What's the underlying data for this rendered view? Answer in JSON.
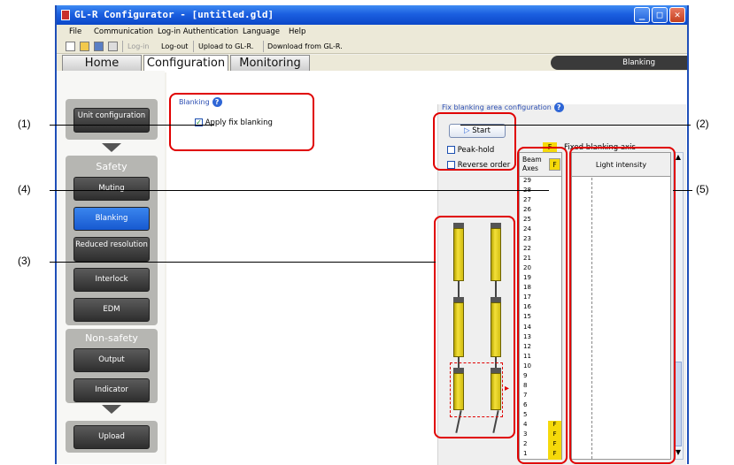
{
  "window": {
    "title": "GL-R Configurator - [untitled.gld]"
  },
  "menu": [
    "File",
    "Communication",
    "Log-in Authentication",
    "Language",
    "Help"
  ],
  "toolbar": {
    "login": "Log-in",
    "logout": "Log-out",
    "upload": "Upload to GL-R.",
    "download": "Download from GL-R."
  },
  "tabs": [
    "Home",
    "Configuration",
    "Monitoring"
  ],
  "status": "Blanking",
  "nav": {
    "unit_config": "Unit configuration",
    "safety": "Safety",
    "muting": "Muting",
    "blanking": "Blanking",
    "reduced": "Reduced resolution",
    "interlock": "Interlock",
    "edm": "EDM",
    "nonsafety": "Non-safety",
    "output": "Output",
    "indicator": "Indicator",
    "upload": "Upload"
  },
  "blanking_group": {
    "title": "Blanking",
    "apply_label": "Apply fix blanking",
    "apply_checked": true
  },
  "fix_area": {
    "title": "Fix blanking area configuration",
    "start": "Start",
    "peak_hold": "Peak-hold",
    "reverse_order": "Reverse order",
    "legend_f": "F",
    "legend_text": "Fixed blanking axis"
  },
  "beam_table": {
    "head_beam": "Beam",
    "head_axes": "Axes",
    "head_f": "F",
    "light_head": "Light intensity",
    "rows": [
      {
        "n": "29",
        "f": ""
      },
      {
        "n": "28",
        "f": ""
      },
      {
        "n": "27",
        "f": ""
      },
      {
        "n": "26",
        "f": ""
      },
      {
        "n": "25",
        "f": ""
      },
      {
        "n": "24",
        "f": ""
      },
      {
        "n": "23",
        "f": ""
      },
      {
        "n": "22",
        "f": ""
      },
      {
        "n": "21",
        "f": ""
      },
      {
        "n": "20",
        "f": ""
      },
      {
        "n": "19",
        "f": ""
      },
      {
        "n": "18",
        "f": ""
      },
      {
        "n": "17",
        "f": ""
      },
      {
        "n": "16",
        "f": ""
      },
      {
        "n": "15",
        "f": ""
      },
      {
        "n": "14",
        "f": ""
      },
      {
        "n": "13",
        "f": ""
      },
      {
        "n": "12",
        "f": ""
      },
      {
        "n": "11",
        "f": ""
      },
      {
        "n": "10",
        "f": ""
      },
      {
        "n": "9",
        "f": ""
      },
      {
        "n": "8",
        "f": ""
      },
      {
        "n": "7",
        "f": ""
      },
      {
        "n": "6",
        "f": ""
      },
      {
        "n": "5",
        "f": ""
      },
      {
        "n": "4",
        "f": "F"
      },
      {
        "n": "3",
        "f": "F"
      },
      {
        "n": "2",
        "f": "F"
      },
      {
        "n": "1",
        "f": "F"
      }
    ]
  },
  "annotations": [
    "(1)",
    "(2)",
    "(3)",
    "(4)",
    "(5)"
  ],
  "colors": {
    "annotation": "#e00000",
    "fixed_axis": "#f5d90a",
    "selected_nav": "#1e66db"
  }
}
